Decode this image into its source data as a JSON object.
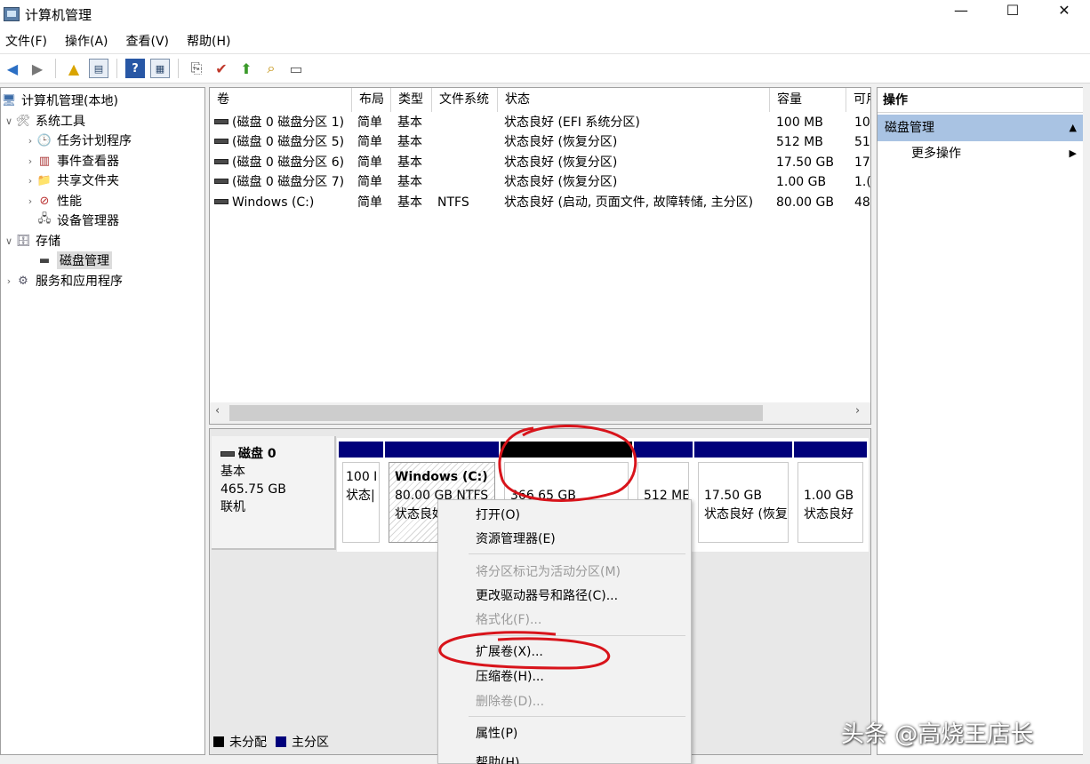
{
  "window": {
    "title": "计算机管理",
    "min": "—",
    "max": "☐",
    "close": "✕"
  },
  "menu": [
    "文件(F)",
    "操作(A)",
    "查看(V)",
    "帮助(H)"
  ],
  "tree": {
    "root": "计算机管理(本地)",
    "system_tools": "系统工具",
    "task_scheduler": "任务计划程序",
    "event_viewer": "事件查看器",
    "shared_folders": "共享文件夹",
    "performance": "性能",
    "device_manager": "设备管理器",
    "storage": "存储",
    "disk_management": "磁盘管理",
    "services": "服务和应用程序"
  },
  "columns": [
    "卷",
    "布局",
    "类型",
    "文件系统",
    "状态",
    "容量",
    "可用"
  ],
  "volumes": [
    {
      "name": "(磁盘 0 磁盘分区 1)",
      "layout": "简单",
      "type": "基本",
      "fs": "",
      "status": "状态良好 (EFI 系统分区)",
      "capacity": "100 MB",
      "free": "10"
    },
    {
      "name": "(磁盘 0 磁盘分区 5)",
      "layout": "简单",
      "type": "基本",
      "fs": "",
      "status": "状态良好 (恢复分区)",
      "capacity": "512 MB",
      "free": "51"
    },
    {
      "name": "(磁盘 0 磁盘分区 6)",
      "layout": "简单",
      "type": "基本",
      "fs": "",
      "status": "状态良好 (恢复分区)",
      "capacity": "17.50 GB",
      "free": "17"
    },
    {
      "name": "(磁盘 0 磁盘分区 7)",
      "layout": "简单",
      "type": "基本",
      "fs": "",
      "status": "状态良好 (恢复分区)",
      "capacity": "1.00 GB",
      "free": "1.("
    },
    {
      "name": "Windows (C:)",
      "layout": "简单",
      "type": "基本",
      "fs": "NTFS",
      "status": "状态良好 (启动, 页面文件, 故障转储, 主分区)",
      "capacity": "80.00 GB",
      "free": "48"
    }
  ],
  "disk": {
    "name": "磁盘 0",
    "type": "基本",
    "size": "465.75 GB",
    "state": "联机"
  },
  "partitions": [
    {
      "line1": "100 I",
      "line2": "状态|"
    },
    {
      "title": "Windows  (C:)",
      "line1": "80.00 GB NTFS",
      "line2": "状态良好"
    },
    {
      "line1": "366.65 GB",
      "line2": ""
    },
    {
      "line1": "512 ME",
      "line2": ""
    },
    {
      "line1": "17.50 GB",
      "line2": "状态良好 (恢复"
    },
    {
      "line1": "1.00 GB",
      "line2": "状态良好"
    }
  ],
  "legend": {
    "unallocated": "未分配",
    "primary": "主分区"
  },
  "actions": {
    "header": "操作",
    "section": "磁盘管理",
    "more": "更多操作"
  },
  "context_menu": {
    "open": "打开(O)",
    "explore": "资源管理器(E)",
    "mark_active": "将分区标记为活动分区(M)",
    "change_letter": "更改驱动器号和路径(C)...",
    "format": "格式化(F)...",
    "extend": "扩展卷(X)...",
    "shrink": "压缩卷(H)...",
    "delete": "删除卷(D)...",
    "properties": "属性(P)",
    "help": "帮助(H)"
  },
  "watermark": "头条 @高烧王店长",
  "colors": {
    "primary_partition": "#00007b",
    "unallocated": "#000000",
    "annotation": "#d8141b",
    "selection": "#a9c3e3"
  }
}
